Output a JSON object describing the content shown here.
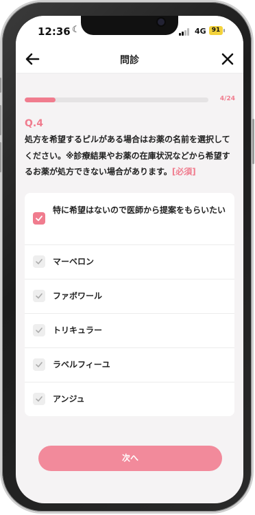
{
  "status_bar": {
    "time": "12:36",
    "network": "4G",
    "battery": "91"
  },
  "header": {
    "title": "問診"
  },
  "progress": {
    "current": 4,
    "total": 24,
    "label": "4/24",
    "fraction": 0.1667
  },
  "question": {
    "number": "Q.4",
    "text": "処方を希望するピルがある場合はお薬の名前を選択してください。※診療結果やお薬の在庫状況などから希望するお薬が処方できない場合があります。",
    "required_tag": "[必須]"
  },
  "options": [
    {
      "label": "特に希望はないので医師から提案をもらいたい",
      "checked": true
    },
    {
      "label": "マーベロン",
      "checked": false
    },
    {
      "label": "ファボワール",
      "checked": false
    },
    {
      "label": "トリキュラー",
      "checked": false
    },
    {
      "label": "ラベルフィーユ",
      "checked": false
    },
    {
      "label": "アンジュ",
      "checked": false
    }
  ],
  "next_button": {
    "label": "次へ"
  },
  "colors": {
    "accent": "#f07c8e",
    "button": "#f28a9b",
    "background": "#f5f3f4"
  },
  "icons": {
    "back": "arrow-left-icon",
    "close": "close-icon",
    "check": "checkmark-icon",
    "moon": "moon-icon"
  }
}
